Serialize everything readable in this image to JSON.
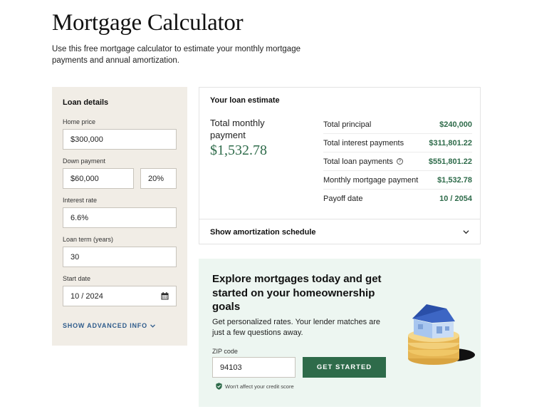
{
  "page": {
    "title": "Mortgage Calculator",
    "subtitle": "Use this free mortgage calculator to estimate your monthly mortgage payments and annual amortization."
  },
  "loan_details": {
    "title": "Loan details",
    "home_price": {
      "label": "Home price",
      "value": "$300,000"
    },
    "down_payment": {
      "label": "Down payment",
      "value": "$60,000",
      "percent": "20%"
    },
    "interest_rate": {
      "label": "Interest rate",
      "value": "6.6%"
    },
    "loan_term": {
      "label": "Loan term (years)",
      "value": "30"
    },
    "start_date": {
      "label": "Start date",
      "value": "10 / 2024",
      "icon": "calendar-icon"
    },
    "advanced_link": "SHOW ADVANCED INFO"
  },
  "estimate": {
    "title": "Your loan estimate",
    "total_monthly_label": "Total monthly payment",
    "total_monthly_value": "$1,532.78",
    "rows": [
      {
        "label": "Total principal",
        "value": "$240,000"
      },
      {
        "label": "Total interest payments",
        "value": "$311,801.22"
      },
      {
        "label": "Total loan payments",
        "value": "$551,801.22",
        "help_icon": "?"
      },
      {
        "label": "Monthly mortgage payment",
        "value": "$1,532.78"
      },
      {
        "label": "Payoff date",
        "value": "10 / 2054"
      }
    ],
    "amortization_toggle": "Show amortization schedule"
  },
  "explore": {
    "heading": "Explore mortgages today and get started on your homeownership goals",
    "description": "Get personalized rates. Your lender matches are just a few questions away.",
    "zip_label": "ZIP code",
    "zip_value": "94103",
    "button": "GET STARTED",
    "credit_note": "Won't affect your credit score"
  },
  "colors": {
    "accent_green": "#2e6b4a",
    "panel_beige": "#f1ede6",
    "explore_bg": "#edf6f1",
    "link_blue": "#2f5c8c"
  }
}
